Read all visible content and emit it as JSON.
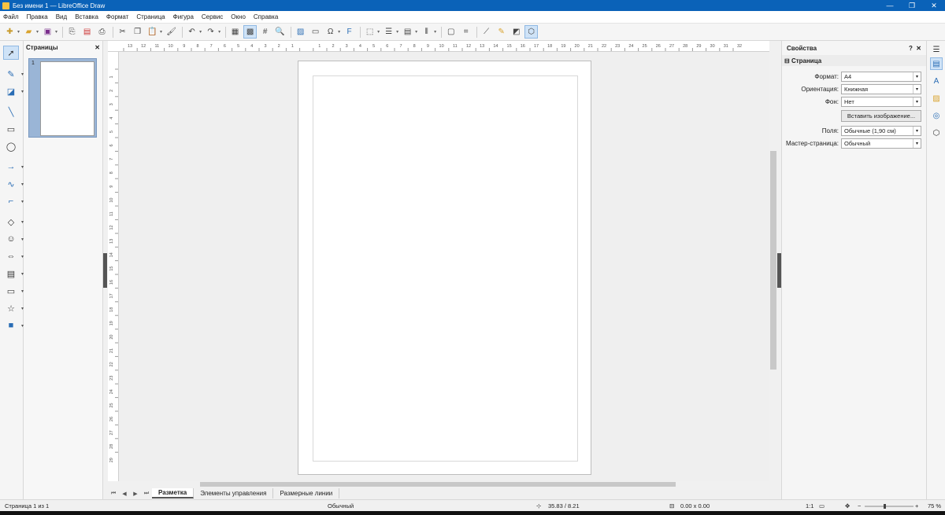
{
  "window": {
    "title": "Без имени 1 — LibreOffice Draw"
  },
  "menu": [
    "Файл",
    "Правка",
    "Вид",
    "Вставка",
    "Формат",
    "Страница",
    "Фигура",
    "Сервис",
    "Окно",
    "Справка"
  ],
  "pages_panel": {
    "title": "Страницы",
    "page_number": "1"
  },
  "properties": {
    "title": "Свойства",
    "section": "Страница",
    "fields": [
      {
        "label": "Формат:",
        "value": "A4"
      },
      {
        "label": "Ориентация:",
        "value": "Книжная"
      },
      {
        "label": "Фон:",
        "value": "Нет"
      }
    ],
    "insert_image_button": "Вставить изображение...",
    "fields2": [
      {
        "label": "Поля:",
        "value": "Обычные (1,90 см)"
      },
      {
        "label": "Мастер-страница:",
        "value": "Обычный"
      }
    ]
  },
  "tabs": [
    "Разметка",
    "Элементы управления",
    "Размерные линии"
  ],
  "status": {
    "page": "Страница 1 из 1",
    "layout": "Обычный",
    "position": "35.83 / 8.21",
    "size": "0.00 x 0.00",
    "scale": "1:1",
    "zoom": "75 %"
  },
  "hruler_labels": [
    "13",
    "12",
    "11",
    "10",
    "9",
    "8",
    "7",
    "6",
    "5",
    "4",
    "3",
    "2",
    "1",
    "",
    "1",
    "2",
    "3",
    "4",
    "5",
    "6",
    "7",
    "8",
    "9",
    "10",
    "11",
    "12",
    "13",
    "14",
    "15",
    "16",
    "17",
    "18",
    "19",
    "20",
    "21",
    "22",
    "23",
    "24",
    "25",
    "26",
    "27",
    "28",
    "29",
    "30",
    "31",
    "32"
  ],
  "vruler_labels": [
    "1",
    "2",
    "3",
    "4",
    "5",
    "6",
    "7",
    "8",
    "9",
    "10",
    "11",
    "12",
    "13",
    "14",
    "15",
    "16",
    "17",
    "18",
    "19",
    "20",
    "21",
    "22",
    "23",
    "24",
    "25",
    "26",
    "27",
    "28",
    "29"
  ]
}
